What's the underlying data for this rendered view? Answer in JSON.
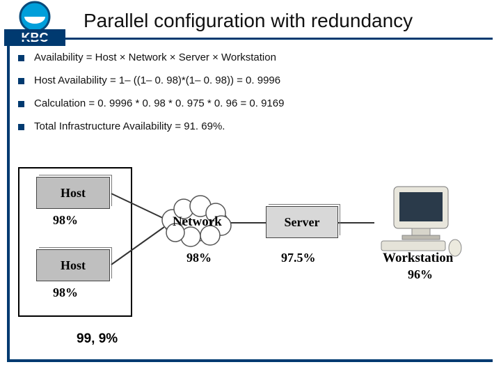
{
  "title": "Parallel configuration with redundancy",
  "logo": {
    "text_top": "KBC"
  },
  "bullets": [
    "Availability = Host × Network × Server × Workstation",
    "Host Availability = 1– ((1– 0. 98)*(1– 0. 98)) = 0. 9996",
    "Calculation = 0. 9996 * 0. 98 * 0. 975 * 0. 96 = 0. 9169",
    "Total Infrastructure Availability = 91. 69%."
  ],
  "diagram": {
    "host1": {
      "label": "Host",
      "pct": "98%"
    },
    "host2": {
      "label": "Host",
      "pct": "98%"
    },
    "network": {
      "label": "Network",
      "pct": "98%"
    },
    "server": {
      "label": "Server",
      "pct": "97.5%"
    },
    "workstation": {
      "label": "Workstation",
      "pct": "96%"
    },
    "combined_host_pct": "99, 9%"
  },
  "chart_data": {
    "type": "table",
    "title": "Parallel configuration with redundancy — component availability",
    "categories": [
      "Host (1)",
      "Host (2)",
      "Host combined",
      "Network",
      "Server",
      "Workstation",
      "Total"
    ],
    "values": [
      0.98,
      0.98,
      0.9996,
      0.98,
      0.975,
      0.96,
      0.9169
    ]
  }
}
